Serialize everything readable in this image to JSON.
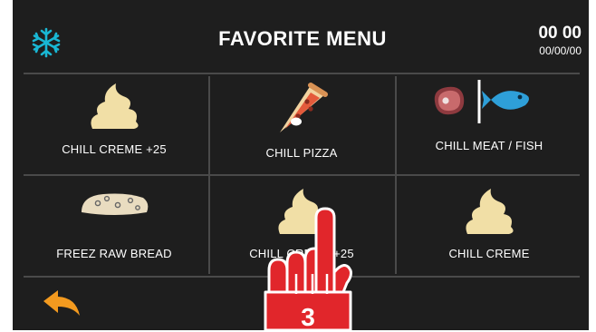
{
  "header": {
    "title": "FAVORITE MENU",
    "time": "00 00",
    "date": "00/00/00",
    "mode_icon": "snowflake-icon",
    "mode_color": "#19b7d4"
  },
  "menu_items": [
    {
      "label": "CHILL CREME +25",
      "icon": "cream-icon"
    },
    {
      "label": "CHILL PIZZA",
      "icon": "pizza-icon"
    },
    {
      "label": "CHILL MEAT / FISH",
      "icon": "meat-fish-icon"
    },
    {
      "label": "FREEZ RAW BREAD",
      "icon": "bread-icon"
    },
    {
      "label": "CHILL CREME +25",
      "icon": "cream-icon"
    },
    {
      "label": "CHILL CREME",
      "icon": "cream-icon"
    }
  ],
  "footer": {
    "back_icon": "back-arrow-icon",
    "back_color": "#f39a1f"
  },
  "overlay": {
    "step_number": "3",
    "color": "#e1262b"
  }
}
